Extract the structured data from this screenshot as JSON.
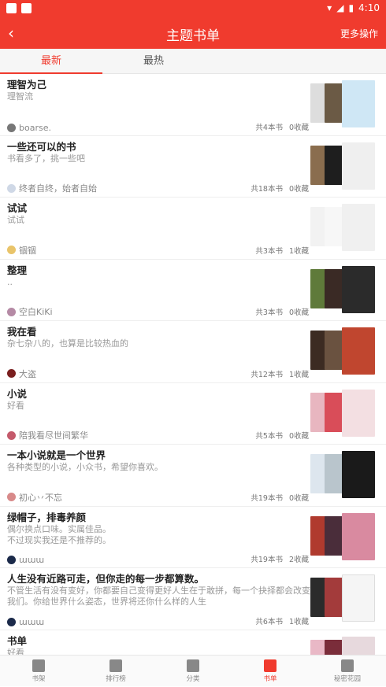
{
  "status_bar": {
    "time": "4:10"
  },
  "header": {
    "title": "主题书单",
    "more_label": "更多操作"
  },
  "tabs": [
    {
      "label": "最新",
      "active": true
    },
    {
      "label": "最热",
      "active": false
    }
  ],
  "lists": [
    {
      "name": "理智为己",
      "desc": "理智流",
      "author": "boarse.",
      "books": "共4本书",
      "likes": "0收藏"
    },
    {
      "name": "一些还可以的书",
      "desc": "书看多了，挑一些吧",
      "author": "终者自终，始者自始",
      "books": "共18本书",
      "likes": "0收藏"
    },
    {
      "name": "试试",
      "desc": "试试",
      "author": "锢锢",
      "books": "共3本书",
      "likes": "1收藏"
    },
    {
      "name": "整理",
      "desc": "..",
      "author": "空白KiKi",
      "books": "共3本书",
      "likes": "0收藏"
    },
    {
      "name": "我在看",
      "desc": "杂七杂八的，也算是比较热血的",
      "author": "大盗",
      "books": "共12本书",
      "likes": "1收藏"
    },
    {
      "name": "小说",
      "desc": "好看",
      "author": "陪我看尽世间繁华",
      "books": "共5本书",
      "likes": "0收藏"
    },
    {
      "name": "一本小说就是一个世界",
      "desc": "各种类型的小说，小众书，希望你喜欢。",
      "author": "初心丷不忘",
      "books": "共19本书",
      "likes": "0收藏"
    },
    {
      "name": "绿帽子，排毒养颜",
      "desc": "偶尔换点口味。实属佳品。\n不过现实我还是不推荐的。",
      "author": "ɯɯɯ",
      "books": "共19本书",
      "likes": "2收藏"
    },
    {
      "name": "人生没有近路可走，但你走的每一步都算数。",
      "desc": "不管生活有没有变好，你都要自己变得更好人生在于敢拼，每一个抉择都会改变我们。你给世界什么姿态，世界将还你什么样的人生",
      "author": "ɯɯɯ",
      "books": "共6本书",
      "likes": "1收藏"
    },
    {
      "name": "书单",
      "desc": "好看",
      "author": "",
      "books": "",
      "likes": ""
    }
  ],
  "bottom_nav": [
    {
      "label": "书架"
    },
    {
      "label": "排行榜"
    },
    {
      "label": "分类"
    },
    {
      "label": "书单",
      "active": true
    },
    {
      "label": "秘密花园"
    }
  ],
  "colors": {
    "accent": "#f03b2e"
  }
}
